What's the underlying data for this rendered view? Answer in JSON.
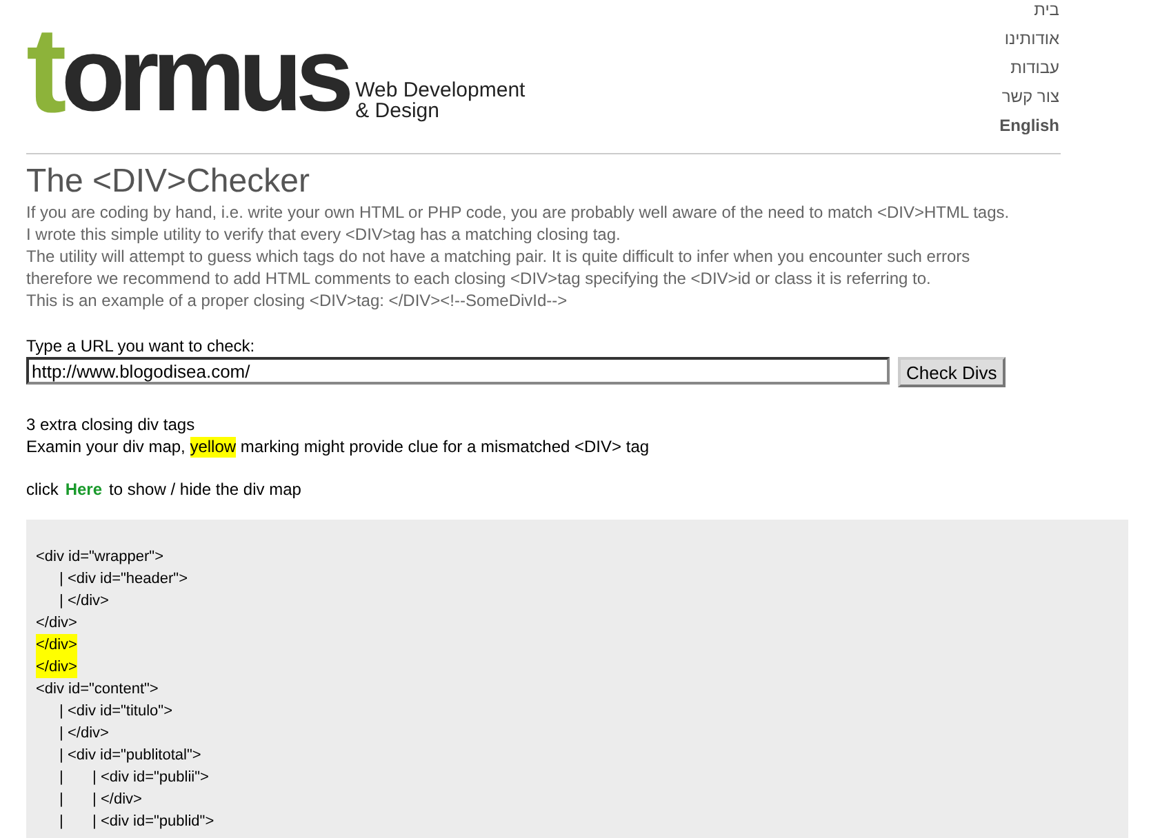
{
  "logo": {
    "mark": "t",
    "name": "ormus",
    "tagline": [
      "Web Development",
      "& Design"
    ]
  },
  "nav": [
    {
      "label": "בית",
      "bold": false
    },
    {
      "label": "אודותינו",
      "bold": false
    },
    {
      "label": "עבודות",
      "bold": false
    },
    {
      "label": "צור קשר",
      "bold": false
    },
    {
      "label": "English",
      "bold": true
    }
  ],
  "title": "The <DIV>Checker",
  "intro": [
    "If you are coding by hand, i.e. write your own HTML or PHP code, you are probably well aware of the need to match <DIV>HTML tags.",
    "I wrote this simple utility to verify that every <DIV>tag has a matching closing tag.",
    "The utility will attempt to guess which tags do not have a matching pair. It is quite difficult to infer when you encounter such errors",
    "therefore we recommend to add HTML comments to each closing <DIV>tag specifying the <DIV>id or class it is referring to.",
    "This is an example of a proper closing <DIV>tag: </DIV><!--SomeDivId-->"
  ],
  "url_form": {
    "label": "Type a URL you want to check:",
    "value": "http://www.blogodisea.com/",
    "button": "Check Divs"
  },
  "result": {
    "summary": "3 extra closing div tags",
    "hint": [
      "Examin your div map, ",
      "yellow",
      " marking might provide clue for a mismatched <DIV> tag"
    ]
  },
  "toggle": {
    "before": "click",
    "link": "Here",
    "after": "to show / hide the div map"
  },
  "div_map": [
    {
      "text": "<div id=\"wrapper\">",
      "highlighted": false,
      "guide": "|",
      "children": [
        {
          "text": "<div id=\"header\">",
          "highlighted": false
        },
        {
          "text": "</div>",
          "highlighted": false
        }
      ]
    },
    {
      "text": "</div>",
      "highlighted": false
    },
    {
      "text": "</div>",
      "highlighted": true
    },
    {
      "text": "</div>",
      "highlighted": true
    },
    {
      "text": "<div id=\"content\">",
      "highlighted": false,
      "guide": "|",
      "children": [
        {
          "text": "<div id=\"titulo\">",
          "highlighted": false
        },
        {
          "text": "</div>",
          "highlighted": false
        },
        {
          "text": "<div id=\"publitotal\">",
          "highlighted": false,
          "guide": "|",
          "children": [
            {
              "text": "<div id=\"publii\">",
              "highlighted": false
            },
            {
              "text": "</div>",
              "highlighted": false
            },
            {
              "text": "<div id=\"publid\">",
              "highlighted": false
            }
          ]
        }
      ]
    }
  ]
}
